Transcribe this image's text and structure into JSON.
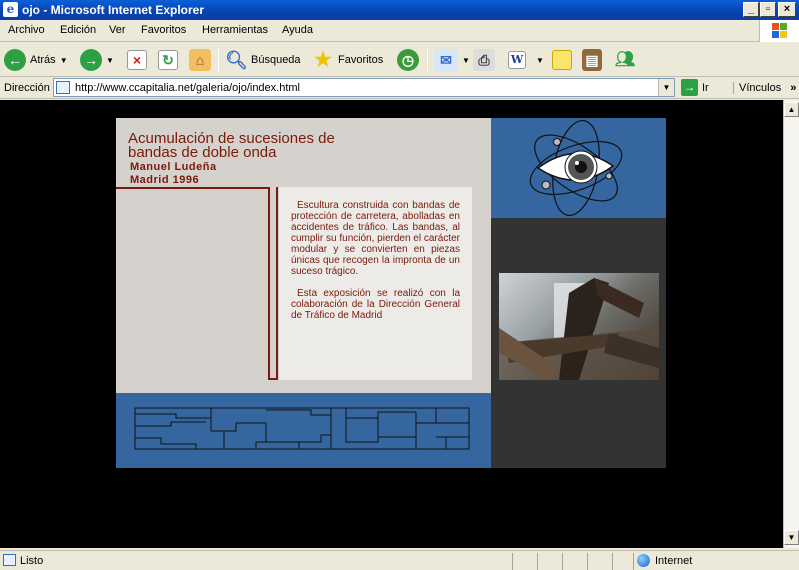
{
  "window": {
    "title": "ojo - Microsoft Internet Explorer",
    "app_glyph": "e"
  },
  "menubar": {
    "items": [
      "Archivo",
      "Edición",
      "Ver",
      "Favoritos",
      "Herramientas",
      "Ayuda"
    ]
  },
  "toolbar": {
    "back_label": "Atrás",
    "search_label": "Búsqueda",
    "favorites_label": "Favoritos"
  },
  "address": {
    "label": "Dirección",
    "url": "http://www.ccapitalia.net/galeria/ojo/index.html",
    "go_label": "Ir",
    "links_label": "Vínculos"
  },
  "page": {
    "title": "Acumulación de sucesiones de bandas de doble onda",
    "artist": "Manuel Ludeña",
    "place_year": "Madrid 1996",
    "paragraph1": "Escultura construida con bandas de protección de carretera, abolladas en accidentes de tráfico. Las bandas, al cumplir su función, pierden el carácter modular y se convierten en piezas únicas que recogen la impronta de un suceso trágico.",
    "paragraph2": "Esta exposición se realizó con la colaboración de la Dirección General de Tráfico de Madrid"
  },
  "status": {
    "text": "Listo",
    "zone": "Internet"
  },
  "colors": {
    "title_red": "#7a1a0a",
    "panel_blue": "#3566a0",
    "panel_gray": "#d5d1cc",
    "dark_panel": "#333333"
  }
}
